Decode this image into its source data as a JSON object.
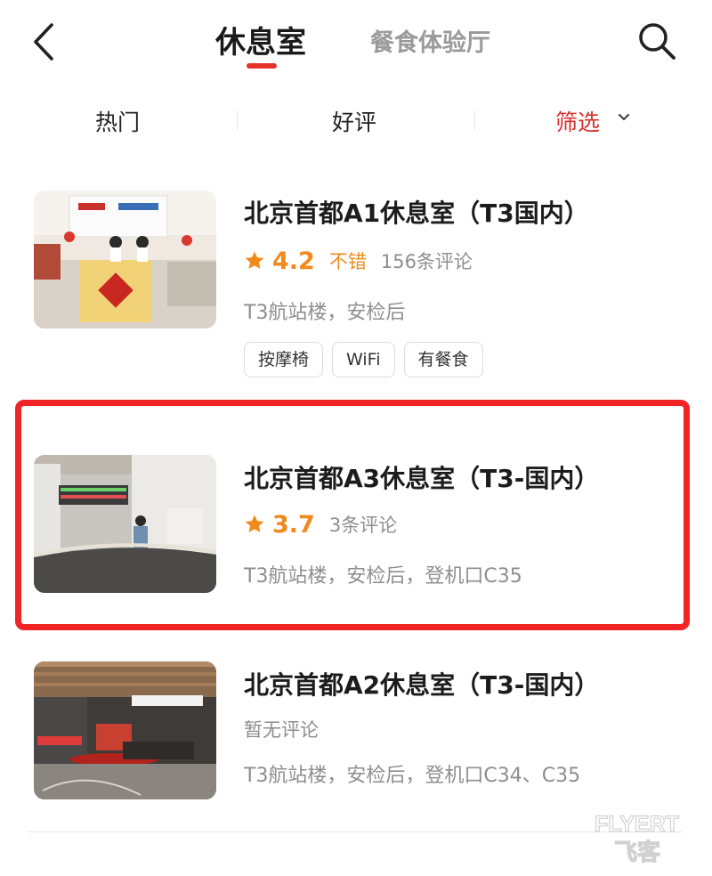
{
  "header": {
    "tabs": [
      {
        "label": "休息室",
        "active": true
      },
      {
        "label": "餐食体验厅",
        "active": false
      }
    ]
  },
  "filters": {
    "hot": "热门",
    "good": "好评",
    "select": "筛选"
  },
  "colors": {
    "accent": "#e5322d",
    "rating": "#f08a1c",
    "highlight": "#f02424"
  },
  "lounges": [
    {
      "title": "北京首都A1休息室（T3国内）",
      "rating": "4.2",
      "rating_label": "不错",
      "reviews": "156条评论",
      "location": "T3航站楼，安检后",
      "amenities": [
        "按摩椅",
        "WiFi",
        "有餐食"
      ]
    },
    {
      "title": "北京首都A3休息室（T3-国内）",
      "rating": "3.7",
      "reviews": "3条评论",
      "location": "T3航站楼，安检后，登机口C35",
      "highlighted": true
    },
    {
      "title": "北京首都A2休息室（T3-国内）",
      "no_reviews": "暂无评论",
      "location": "T3航站楼，安检后，登机口C34、C35"
    }
  ],
  "watermark": {
    "line1": "FLYERT",
    "line2": "飞客"
  }
}
